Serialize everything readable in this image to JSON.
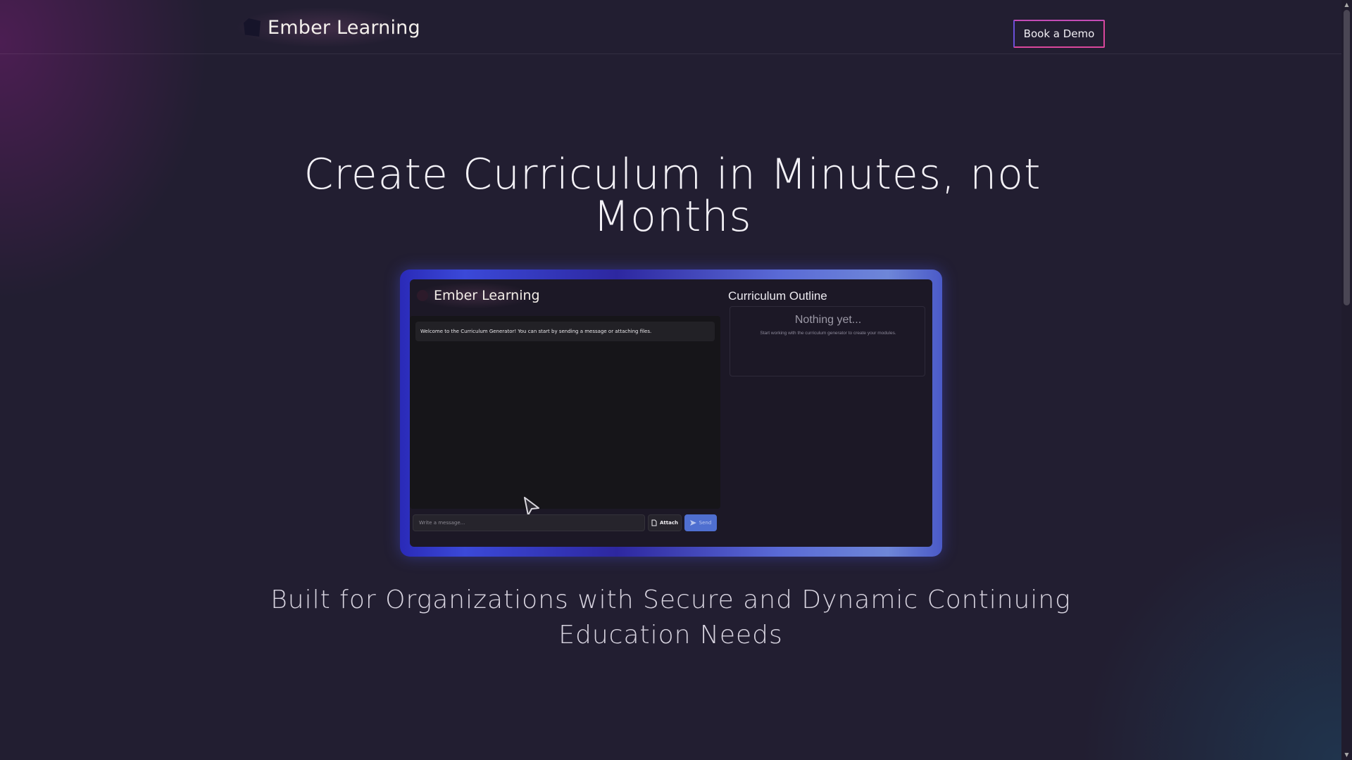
{
  "header": {
    "brand_name": "Ember Learning",
    "demo_button": "Book a Demo"
  },
  "hero": {
    "title": "Create Curriculum in Minutes, not Months",
    "subtitle": "Built for Organizations with Secure and Dynamic Continuing Education Needs"
  },
  "preview": {
    "brand_name": "Ember Learning",
    "welcome_message": "Welcome to the Curriculum Generator! You can start by sending a message or attaching files.",
    "input_placeholder": "Write a message...",
    "attach_label": "Attach",
    "send_label": "Send",
    "outline_title": "Curriculum Outline",
    "empty_title": "Nothing yet...",
    "empty_subtitle": "Start working with the curriculum generator to create your modules."
  },
  "colors": {
    "background": "#221e31",
    "button_border": "#d9479c",
    "frame_accent": "#3b49d8",
    "send_button": "#4f6fd0"
  },
  "icons": [
    "logo-icon",
    "attach-icon",
    "send-icon",
    "cursor-icon",
    "scroll-up-icon",
    "scroll-down-icon"
  ]
}
